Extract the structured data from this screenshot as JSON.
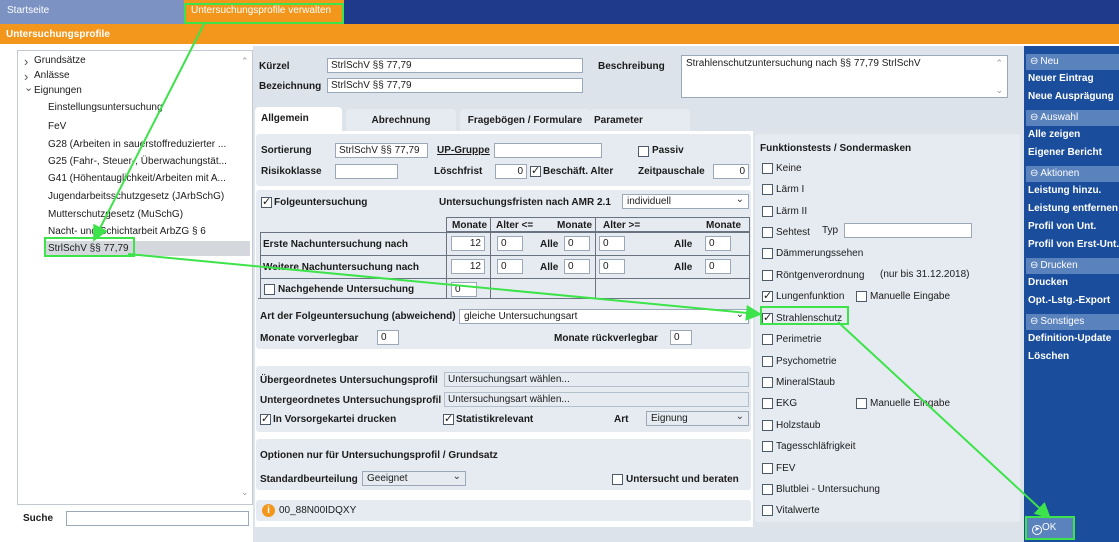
{
  "topbar": {
    "tab_home": "Startseite",
    "tab_active": "Untersuchungsprofile verwalten"
  },
  "titlebar": {
    "title": "Untersuchungsprofile"
  },
  "tree": {
    "items": [
      {
        "label": "Grundsätze",
        "type": "collapsed"
      },
      {
        "label": "Anlässe",
        "type": "collapsed"
      },
      {
        "label": "Eignungen",
        "type": "expanded"
      },
      {
        "label": "Einstellungsuntersuchung",
        "type": "child"
      },
      {
        "label": "FeV",
        "type": "child"
      },
      {
        "label": "G28 (Arbeiten in sauerstoffreduzierter ...",
        "type": "child"
      },
      {
        "label": "G25 (Fahr-, Steuer-, Überwachungstät...",
        "type": "child"
      },
      {
        "label": "G41 (Höhentauglichkeit/Arbeiten mit A...",
        "type": "child"
      },
      {
        "label": "Jugendarbeitsschutzgesetz (JArbSchG)",
        "type": "child"
      },
      {
        "label": "Mutterschutzgesetz (MuSchG)",
        "type": "child"
      },
      {
        "label": "Nacht- und Schichtarbeit ArbZG § 6",
        "type": "child"
      },
      {
        "label": "StrlSchV §§ 77,79",
        "type": "selected"
      }
    ]
  },
  "search": {
    "label": "Suche",
    "value": ""
  },
  "header": {
    "kuerzel_label": "Kürzel",
    "kuerzel_value": "StrlSchV §§ 77,79",
    "bezeichnung_label": "Bezeichnung",
    "bezeichnung_value": "StrlSchV §§ 77,79",
    "beschreibung_label": "Beschreibung",
    "beschreibung_value": "Strahlenschutzuntersuchung nach §§ 77,79 StrlSchV"
  },
  "tabs": [
    "Allgemein",
    "Abrechnung",
    "Fragebögen / Formulare",
    "Parameter"
  ],
  "general": {
    "sortierung_label": "Sortierung",
    "sortierung_value": "StrlSchV §§ 77,79",
    "up_gruppe_label": "UP-Gruppe",
    "up_gruppe_value": "",
    "passiv_label": "Passiv",
    "risikoklasse_label": "Risikoklasse",
    "risikoklasse_value": "",
    "loeschfrist_label": "Löschfrist",
    "loeschfrist_value": "0",
    "beschaeft_alter_label": "Beschäft. Alter",
    "zeitpauschale_label": "Zeitpauschale",
    "zeitpauschale_value": "0"
  },
  "followup": {
    "folge_label": "Folgeuntersuchung",
    "fristen_label": "Untersuchungsfristen nach AMR 2.1",
    "fristen_value": "individuell",
    "col_monate": "Monate",
    "col_alter_le": "Alter <=",
    "col_monate2": "Monate",
    "col_alter_ge": "Alter >=",
    "col_monate3": "Monate",
    "row1_label": "Erste Nachuntersuchung nach",
    "row1": [
      "12",
      "0",
      "Alle",
      "0",
      "0",
      "Alle",
      "0"
    ],
    "row2_label": "Weitere Nachuntersuchung nach",
    "row2": [
      "12",
      "0",
      "Alle",
      "0",
      "0",
      "Alle",
      "0"
    ],
    "row3_label": "Nachgehende Untersuchung",
    "row3_value": "0",
    "art_label": "Art der Folgeuntersuchung (abweichend)",
    "art_value": "gleiche Untersuchungsart",
    "vorverlegbar_label": "Monate vorverlegbar",
    "vorverlegbar_value": "0",
    "rueckverlegbar_label": "Monate rückverlegbar",
    "rueckverlegbar_value": "0"
  },
  "profile": {
    "uebergeordnet_label": "Übergeordnetes Untersuchungsprofil",
    "uebergeordnet_value": "Untersuchungsart wählen...",
    "untergeordnet_label": "Untergeordnetes Untersuchungsprofil",
    "untergeordnet_value": "Untersuchungsart wählen...",
    "vorsorge_label": "In Vorsorgekartei drucken",
    "statistik_label": "Statistikrelevant",
    "art_label": "Art",
    "art_value": "Eignung"
  },
  "options": {
    "title": "Optionen nur für Untersuchungsprofil / Grundsatz",
    "standard_label": "Standardbeurteilung",
    "standard_value": "Geeignet",
    "untersucht_label": "Untersucht und beraten"
  },
  "info": {
    "code": "00_88N00IDQXY"
  },
  "functions": {
    "title": "Funktionstests / Sondermasken",
    "items": [
      {
        "label": "Keine",
        "checked": false
      },
      {
        "label": "Lärm I",
        "checked": false
      },
      {
        "label": "Lärm II",
        "checked": false
      },
      {
        "label": "Sehtest",
        "checked": false
      },
      {
        "label": "Dämmerungssehen",
        "checked": false
      },
      {
        "label": "Röntgenverordnung",
        "checked": false
      },
      {
        "label": "Lungenfunktion",
        "checked": true
      },
      {
        "label": "Strahlenschutz",
        "checked": true
      },
      {
        "label": "Perimetrie",
        "checked": false
      },
      {
        "label": "Psychometrie",
        "checked": false
      },
      {
        "label": "MineralStaub",
        "checked": false
      },
      {
        "label": "EKG",
        "checked": false
      },
      {
        "label": "Holzstaub",
        "checked": false
      },
      {
        "label": "Tagesschläfrigkeit",
        "checked": false
      },
      {
        "label": "FEV",
        "checked": false
      },
      {
        "label": "Blutblei - Untersuchung",
        "checked": false
      },
      {
        "label": "Vitalwerte",
        "checked": false
      }
    ],
    "typ_label": "Typ",
    "roentgen_note": "(nur bis 31.12.2018)",
    "manuelle_label": "Manuelle Eingabe",
    "manuelle2_label": "Manuelle Eingabe"
  },
  "right_panel": {
    "sections": [
      {
        "title": "Neu",
        "items": [
          "Neuer Eintrag",
          "Neue Ausprägung"
        ]
      },
      {
        "title": "Auswahl",
        "items": [
          "Alle zeigen",
          "Eigener Bericht"
        ]
      },
      {
        "title": "Aktionen",
        "items": [
          "Leistung hinzu.",
          "Leistung entfernen",
          "Profil von Unt.",
          "Profil von Erst-Unt."
        ]
      },
      {
        "title": "Drucken",
        "items": [
          "Drucken",
          "Opt.-Lstg.-Export"
        ]
      },
      {
        "title": "Sonstiges",
        "items": [
          "Definition-Update",
          "Löschen"
        ]
      }
    ],
    "ok_label": "OK"
  },
  "colors": {
    "orange": "#f2961c",
    "navy": "#1f3a8a",
    "panel_blue": "#1a4e9c",
    "section_blue": "#5a82bd",
    "group_bg": "#e6ebf1",
    "annotation_green": "#3de34a"
  }
}
